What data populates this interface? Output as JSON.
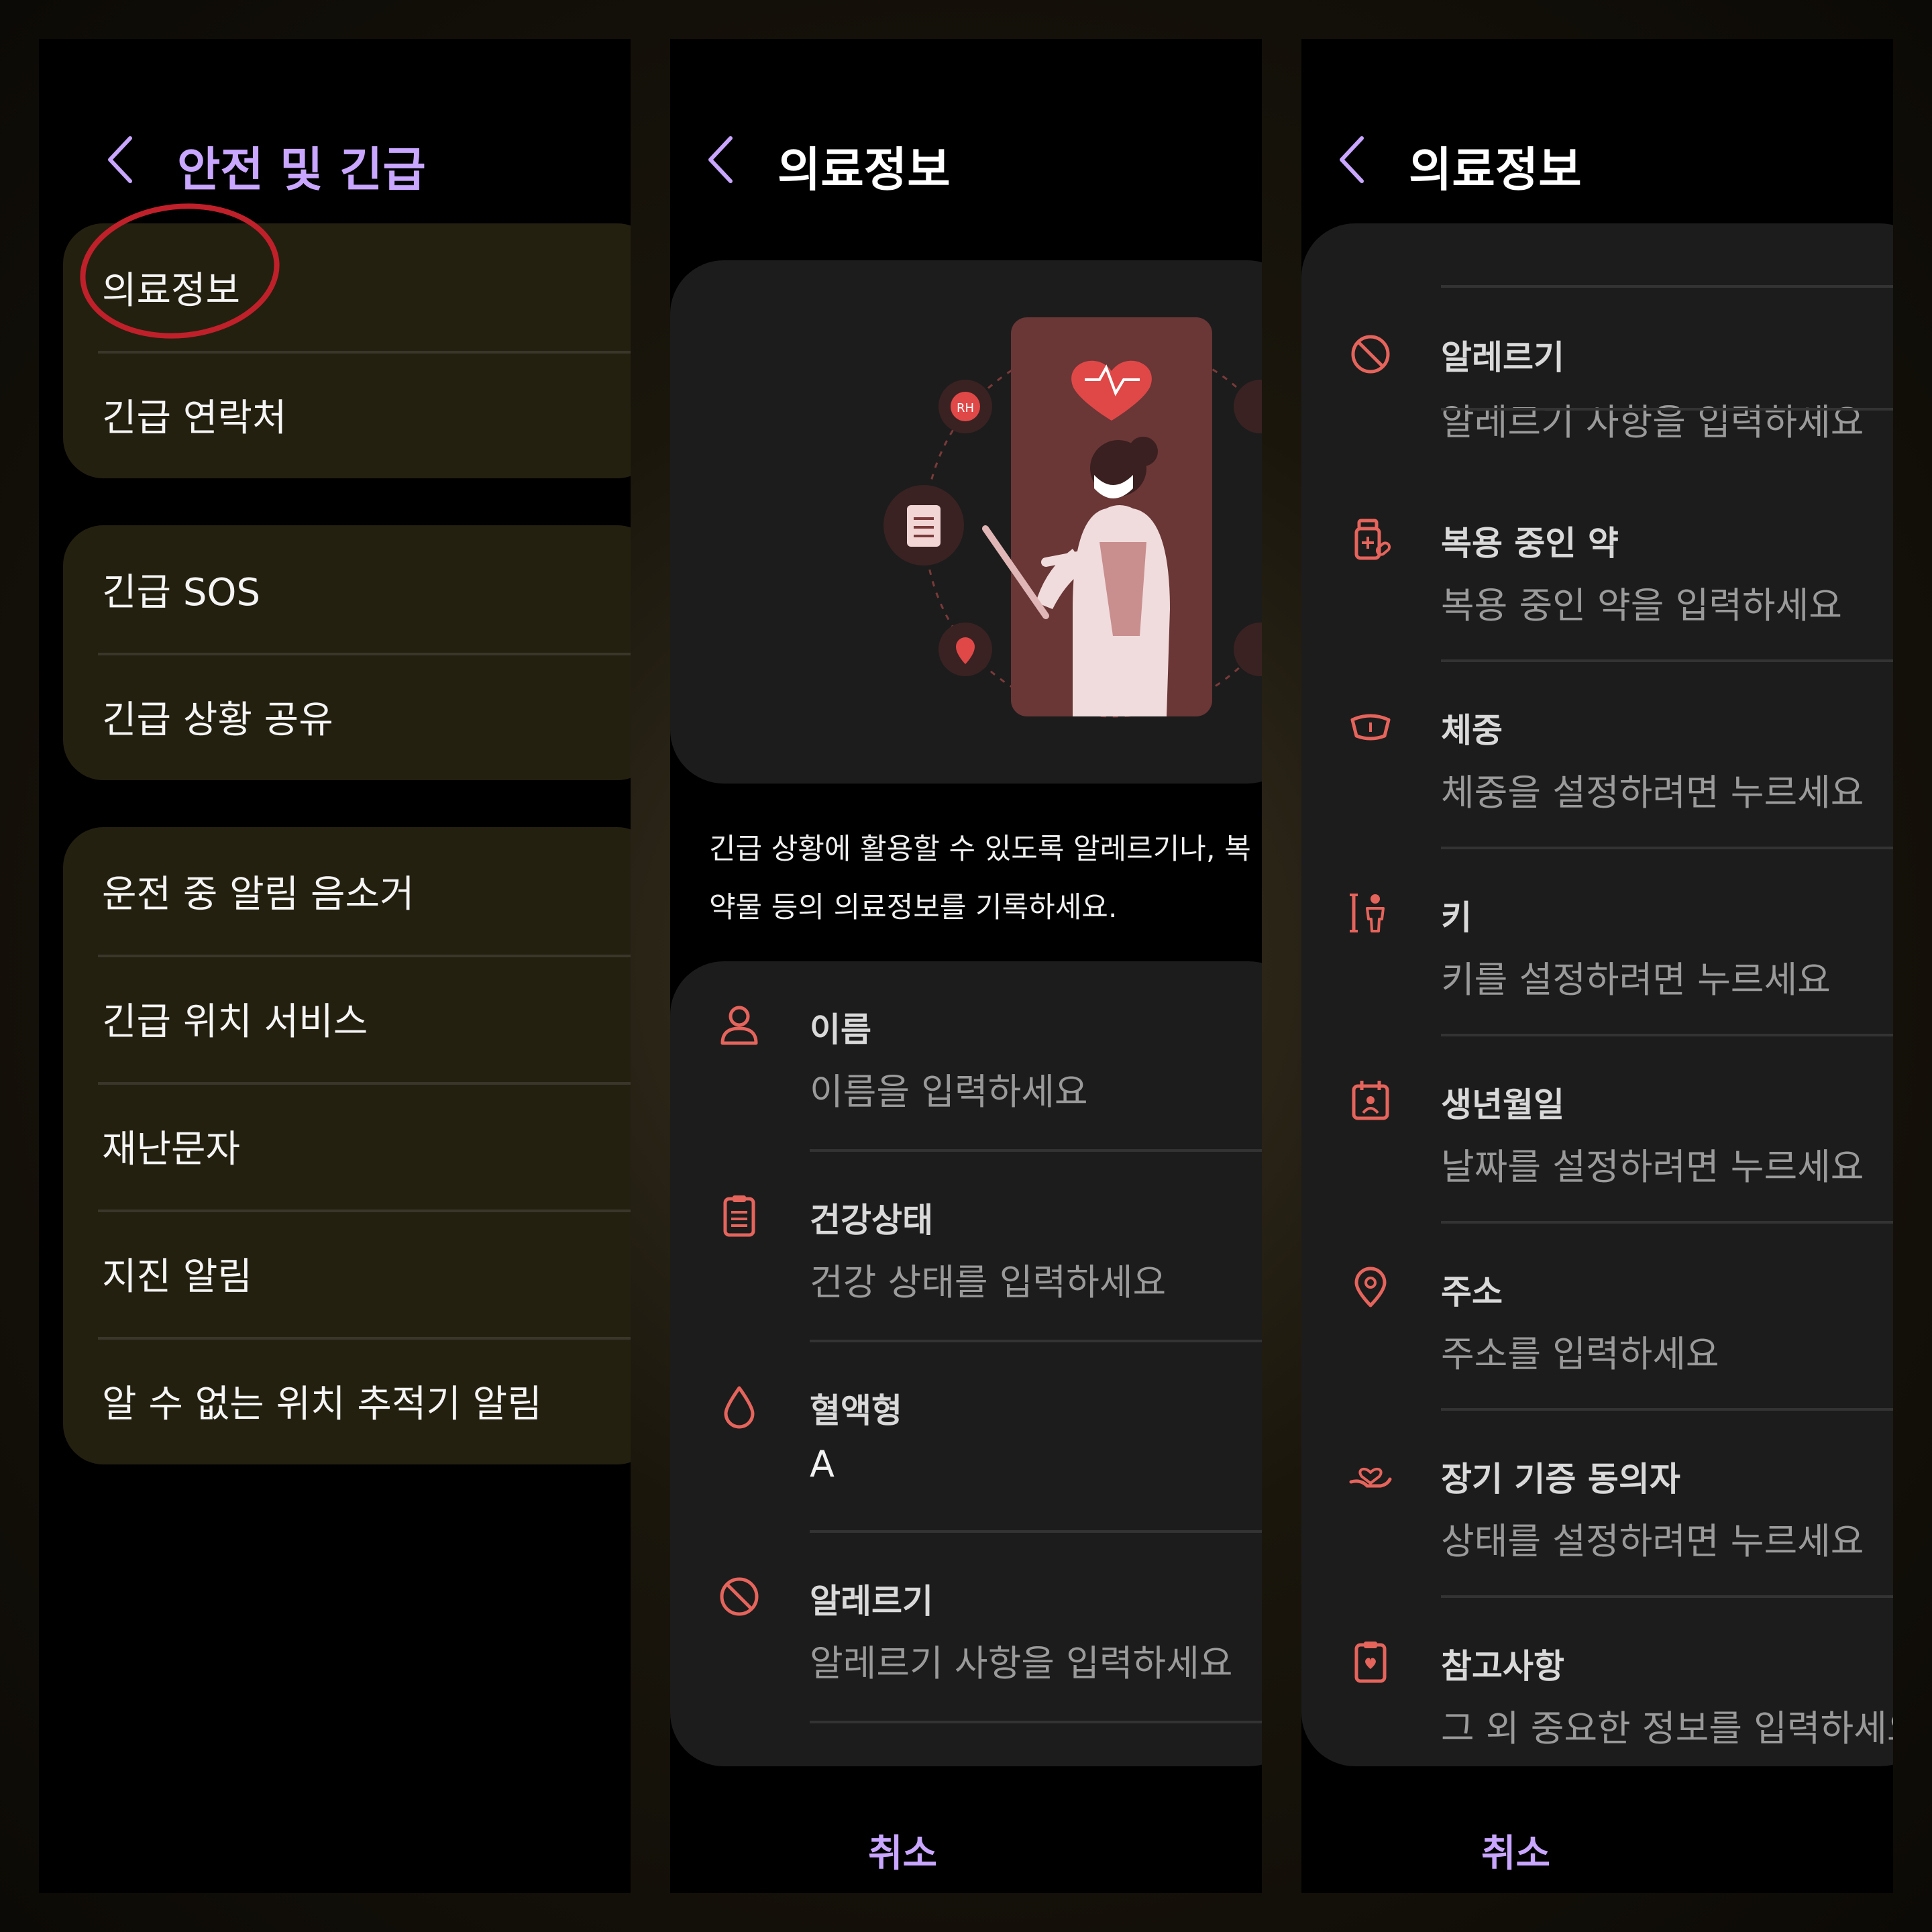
{
  "panel1": {
    "title": "안전 및 긴급",
    "groups": [
      [
        "의료정보",
        "긴급 연락처"
      ],
      [
        "긴급 SOS",
        "긴급 상황 공유"
      ],
      [
        "운전 중 알림 음소거",
        "긴급 위치 서비스",
        "재난문자",
        "지진 알림",
        "알 수 없는 위치 추적기 알림"
      ]
    ]
  },
  "panel2": {
    "title": "의료정보",
    "description": "긴급 상황에 활용할 수 있도록 알레르기나, 복\n약물 등의 의료정보를 기록하세요.",
    "illustration_badge": "RH",
    "items": [
      {
        "label": "이름",
        "value": "이름을 입력하세요",
        "icon": "person-icon"
      },
      {
        "label": "건강상태",
        "value": "건강 상태를 입력하세요",
        "icon": "clipboard-icon"
      },
      {
        "label": "혈액형",
        "value": "A",
        "icon": "blood-drop-icon"
      },
      {
        "label": "알레르기",
        "value": "알레르기 사항을 입력하세요",
        "icon": "no-allergy-icon"
      }
    ],
    "cancel": "취소"
  },
  "panel3": {
    "title": "의료정보",
    "items": [
      {
        "label": "알레르기",
        "value": "알레르기 사항을 입력하세요",
        "icon": "no-allergy-icon"
      },
      {
        "label": "복용 중인 약",
        "value": "복용 중인 약을 입력하세요",
        "icon": "medicine-icon"
      },
      {
        "label": "체중",
        "value": "체중을 설정하려면 누르세요",
        "icon": "scale-icon"
      },
      {
        "label": "키",
        "value": "키를 설정하려면 누르세요",
        "icon": "height-icon"
      },
      {
        "label": "생년월일",
        "value": "날짜를 설정하려면 누르세요",
        "icon": "calendar-icon"
      },
      {
        "label": "주소",
        "value": "주소를 입력하세요",
        "icon": "location-icon"
      },
      {
        "label": "장기 기증 동의자",
        "value": "상태를 설정하려면 누르세요",
        "icon": "organ-donor-icon"
      },
      {
        "label": "참고사항",
        "value": "그 외 중요한 정보를 입력하세요",
        "icon": "notes-icon"
      }
    ],
    "cancel": "취소"
  },
  "colors": {
    "accent": "#c9a6ff",
    "icon": "#e5645c",
    "group_bg": "#242010",
    "list_bg": "#1c1c1c"
  }
}
